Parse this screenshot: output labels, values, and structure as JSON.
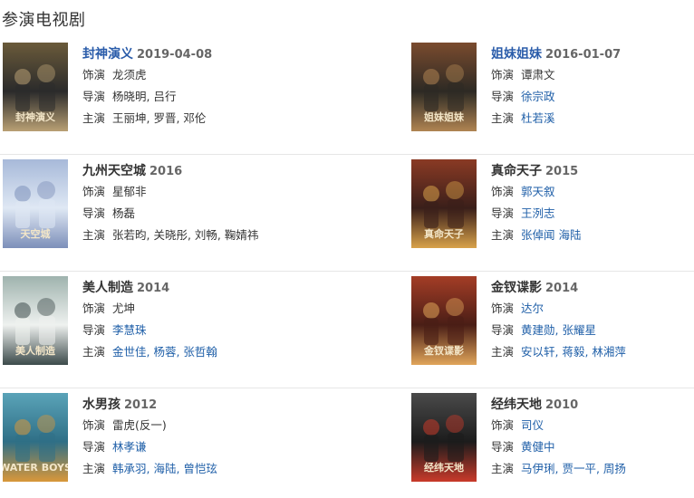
{
  "section_title": "参演电视剧",
  "items": [
    {
      "title": "封神演义",
      "year": "2019-04-08",
      "title_link": true,
      "role_label": "饰演",
      "role": "龙须虎",
      "role_link": false,
      "director_label": "导演",
      "director": "杨晓明, 吕行",
      "director_link": false,
      "cast_label": "主演",
      "cast": "王丽坤, 罗晋, 邓伦",
      "cast_link": false,
      "poster_text": "封神演义",
      "poster_colors": [
        "#2b2b2b",
        "#6a5a3a",
        "#b9a074"
      ]
    },
    {
      "title": "姐妹姐妹",
      "year": "2016-01-07",
      "title_link": true,
      "role_label": "饰演",
      "role": "谭肃文",
      "role_link": false,
      "director_label": "导演",
      "director": "徐宗政",
      "director_link": true,
      "cast_label": "主演",
      "cast": "杜若溪",
      "cast_link": true,
      "poster_text": "姐妹姐妹",
      "poster_colors": [
        "#2d2a24",
        "#7a4b2e",
        "#b08452"
      ]
    },
    {
      "title": "九州天空城",
      "year": "2016",
      "title_link": false,
      "role_label": "饰演",
      "role": "星郁非",
      "role_link": false,
      "director_label": "导演",
      "director": "杨磊",
      "director_link": false,
      "cast_label": "主演",
      "cast": "张若昀, 关晓彤, 刘畅, 鞠婧祎",
      "cast_link": false,
      "poster_text": "天空城",
      "poster_colors": [
        "#dfe8f4",
        "#a7b9d9",
        "#7c8fb9"
      ]
    },
    {
      "title": "真命天子",
      "year": "2015",
      "title_link": false,
      "role_label": "饰演",
      "role": "郭天叙",
      "role_link": true,
      "director_label": "导演",
      "director": "王洌志",
      "director_link": true,
      "cast_label": "主演",
      "cast": "张倬闻 海陆",
      "cast_link": true,
      "poster_text": "真命天子",
      "poster_colors": [
        "#3a1f1a",
        "#8a3a24",
        "#d8a24a"
      ]
    },
    {
      "title": "美人制造",
      "year": "2014",
      "title_link": false,
      "role_label": "饰演",
      "role": "尤坤",
      "role_link": false,
      "director_label": "导演",
      "director": "李慧珠",
      "director_link": true,
      "cast_label": "主演",
      "cast": "金世佳, 杨蓉, 张哲翰",
      "cast_link": true,
      "poster_text": "美人制造",
      "poster_colors": [
        "#eef1ef",
        "#9fb3ae",
        "#3c4a4a"
      ]
    },
    {
      "title": "金钗谍影",
      "year": "2014",
      "title_link": false,
      "role_label": "饰演",
      "role": "达尔",
      "role_link": true,
      "director_label": "导演",
      "director": "黄建勋, 张耀星",
      "director_link": true,
      "cast_label": "主演",
      "cast": "安以轩, 蒋毅, 林湘萍",
      "cast_link": true,
      "poster_text": "金钗谍影",
      "poster_colors": [
        "#4a1e16",
        "#a43d26",
        "#e0a55a"
      ]
    },
    {
      "title": "水男孩",
      "year": "2012",
      "title_link": false,
      "role_label": "饰演",
      "role": "雷虎(反一)",
      "role_link": false,
      "director_label": "导演",
      "director": "林孝谦",
      "director_link": true,
      "cast_label": "主演",
      "cast": "韩承羽, 海陆, 曾恺玹",
      "cast_link": true,
      "poster_text": "WATER BOYS",
      "poster_colors": [
        "#2f6f86",
        "#5aa3b8",
        "#d9973a"
      ]
    },
    {
      "title": "经纬天地",
      "year": "2010",
      "title_link": false,
      "role_label": "饰演",
      "role": "司仪",
      "role_link": true,
      "director_label": "导演",
      "director": "黄健中",
      "director_link": true,
      "cast_label": "主演",
      "cast": "马伊琍, 贾一平, 周扬",
      "cast_link": true,
      "poster_text": "经纬天地",
      "poster_colors": [
        "#1c1c1c",
        "#4a4a4a",
        "#c93a2a"
      ]
    }
  ]
}
